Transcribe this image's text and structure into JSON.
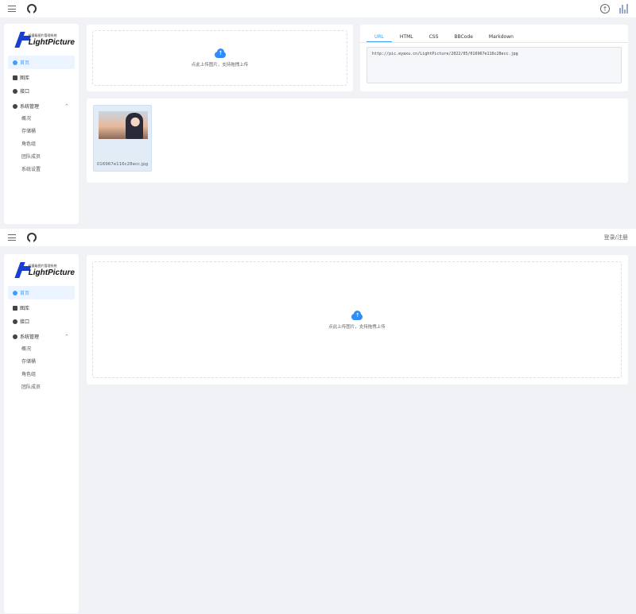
{
  "app": {
    "logo_subtitle": "轻量级图片管理系统",
    "logo_name": "LightPicture"
  },
  "shot1": {
    "sidebar": {
      "items": [
        {
          "label": "首页",
          "active": true
        },
        {
          "label": "图库"
        },
        {
          "label": "接口"
        },
        {
          "label": "系统管理",
          "expanded": true
        }
      ],
      "sub_items": [
        "概况",
        "存储桶",
        "角色组",
        "团队成员",
        "系统设置"
      ]
    },
    "upload": {
      "text": "点此上传图片，支持拖拽上传"
    },
    "link_tabs": [
      "URL",
      "HTML",
      "CSS",
      "BBCode",
      "Markdown"
    ],
    "active_tab": "URL",
    "link_value": "http://pic.eyaxu.cn/LightPicture/2022/05/016967e116c28ecc.jpg",
    "image": {
      "filename": "016967e116c28ecc.jpg"
    }
  },
  "shot2": {
    "header": {
      "auth_label": "登录/注册"
    },
    "sidebar": {
      "items": [
        {
          "label": "首页",
          "active": true
        },
        {
          "label": "图库"
        },
        {
          "label": "接口"
        },
        {
          "label": "系统管理",
          "expanded": true
        }
      ],
      "sub_items": [
        "概况",
        "存储桶",
        "角色组",
        "团队成员"
      ]
    },
    "upload": {
      "text": "点此上传图片，支持拖拽上传"
    }
  },
  "colors": {
    "accent": "#409eff",
    "cloud": "#2f8dfa",
    "logo": "#1a3fcf",
    "background": "#f0f2f5"
  },
  "icons": [
    "menu-icon",
    "github-icon",
    "upload-circle-icon",
    "bar-chart-icon",
    "cloud-upload-icon",
    "home-icon",
    "gallery-icon",
    "api-icon",
    "settings-icon",
    "chevron-up-icon"
  ]
}
